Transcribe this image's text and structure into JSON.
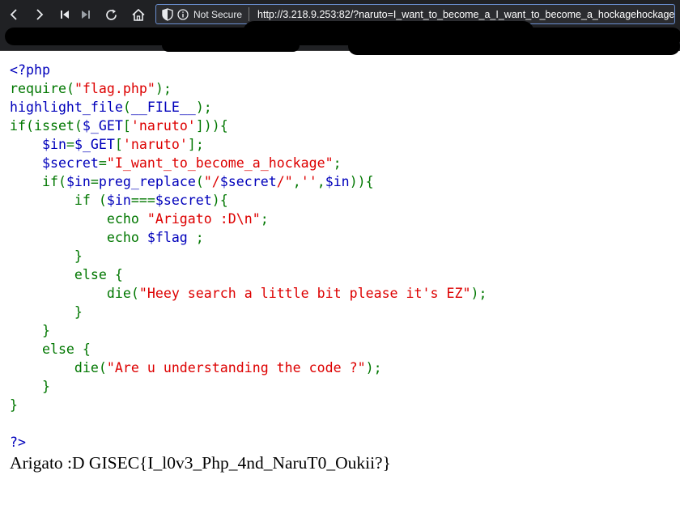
{
  "browser": {
    "not_secure_label": "Not Secure",
    "url": "http://3.218.9.253:82/?naruto=I_want_to_become_a_I_want_to_become_a_hockagehockage",
    "icons": [
      "back-icon",
      "forward-icon",
      "skip-back-icon",
      "skip-forward-icon",
      "reload-icon",
      "home-icon",
      "shield-icon",
      "info-icon"
    ]
  },
  "colors": {
    "php_default": "#0000bb",
    "php_keyword": "#007700",
    "php_string": "#dd0000",
    "chrome_bg": "#202124",
    "address_bar_border": "#6a8fd1"
  },
  "source": {
    "lines": [
      [
        {
          "t": "<?php",
          "c": "html"
        }
      ],
      [
        {
          "t": "require",
          "c": "kw"
        },
        {
          "t": "(",
          "c": "kw"
        },
        {
          "t": "\"flag.php\"",
          "c": "str"
        },
        {
          "t": ");",
          "c": "kw"
        }
      ],
      [
        {
          "t": "highlight_file",
          "c": "html"
        },
        {
          "t": "(",
          "c": "kw"
        },
        {
          "t": "__FILE__",
          "c": "html"
        },
        {
          "t": ");",
          "c": "kw"
        }
      ],
      [
        {
          "t": "if(isset(",
          "c": "kw"
        },
        {
          "t": "$_GET",
          "c": "html"
        },
        {
          "t": "[",
          "c": "kw"
        },
        {
          "t": "'naruto'",
          "c": "str"
        },
        {
          "t": "])){",
          "c": "kw"
        }
      ],
      [
        {
          "t": "    ",
          "c": "kw"
        },
        {
          "t": "$in",
          "c": "html"
        },
        {
          "t": "=",
          "c": "kw"
        },
        {
          "t": "$_GET",
          "c": "html"
        },
        {
          "t": "[",
          "c": "kw"
        },
        {
          "t": "'naruto'",
          "c": "str"
        },
        {
          "t": "];",
          "c": "kw"
        }
      ],
      [
        {
          "t": "    ",
          "c": "kw"
        },
        {
          "t": "$secret",
          "c": "html"
        },
        {
          "t": "=",
          "c": "kw"
        },
        {
          "t": "\"I_want_to_become_a_hockage\"",
          "c": "str"
        },
        {
          "t": ";",
          "c": "kw"
        }
      ],
      [
        {
          "t": "    if(",
          "c": "kw"
        },
        {
          "t": "$in",
          "c": "html"
        },
        {
          "t": "=",
          "c": "kw"
        },
        {
          "t": "preg_replace",
          "c": "html"
        },
        {
          "t": "(",
          "c": "kw"
        },
        {
          "t": "\"/",
          "c": "str"
        },
        {
          "t": "$secret",
          "c": "html"
        },
        {
          "t": "/\"",
          "c": "str"
        },
        {
          "t": ",",
          "c": "kw"
        },
        {
          "t": "''",
          "c": "str"
        },
        {
          "t": ",",
          "c": "kw"
        },
        {
          "t": "$in",
          "c": "html"
        },
        {
          "t": ")){",
          "c": "kw"
        }
      ],
      [
        {
          "t": "        if (",
          "c": "kw"
        },
        {
          "t": "$in",
          "c": "html"
        },
        {
          "t": "===",
          "c": "kw"
        },
        {
          "t": "$secret",
          "c": "html"
        },
        {
          "t": "){",
          "c": "kw"
        }
      ],
      [
        {
          "t": "            echo ",
          "c": "kw"
        },
        {
          "t": "\"Arigato :D\\n\"",
          "c": "str"
        },
        {
          "t": ";",
          "c": "kw"
        }
      ],
      [
        {
          "t": "            echo ",
          "c": "kw"
        },
        {
          "t": "$flag ",
          "c": "html"
        },
        {
          "t": ";",
          "c": "kw"
        }
      ],
      [
        {
          "t": "        }",
          "c": "kw"
        }
      ],
      [
        {
          "t": "        else {",
          "c": "kw"
        }
      ],
      [
        {
          "t": "            die(",
          "c": "kw"
        },
        {
          "t": "\"Heey search a little bit please it's EZ\"",
          "c": "str"
        },
        {
          "t": ");",
          "c": "kw"
        }
      ],
      [
        {
          "t": "        }",
          "c": "kw"
        }
      ],
      [
        {
          "t": "    }",
          "c": "kw"
        }
      ],
      [
        {
          "t": "    else {",
          "c": "kw"
        }
      ],
      [
        {
          "t": "        die(",
          "c": "kw"
        },
        {
          "t": "\"Are u understanding the code ?\"",
          "c": "str"
        },
        {
          "t": ");",
          "c": "kw"
        }
      ],
      [
        {
          "t": "    }",
          "c": "kw"
        }
      ],
      [
        {
          "t": "}",
          "c": "kw"
        }
      ],
      [],
      [
        {
          "t": "?>",
          "c": "html"
        }
      ]
    ]
  },
  "output": {
    "text": "Arigato :D GISEC{I_l0v3_Php_4nd_NaruT0_Oukii?}"
  }
}
